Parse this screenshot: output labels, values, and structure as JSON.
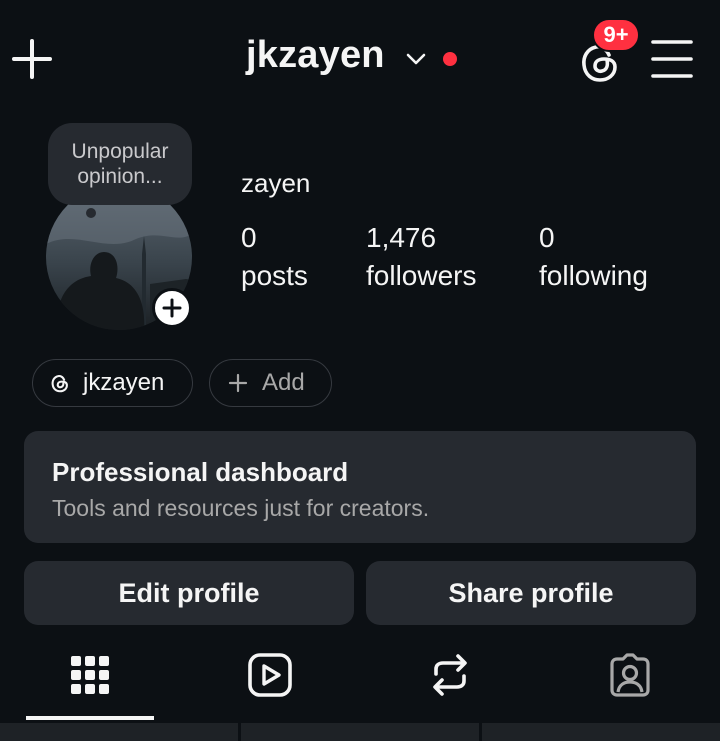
{
  "header": {
    "username": "jkzayen",
    "notifications_badge": "9+",
    "icons": {
      "create": "plus-icon",
      "account_switch": "chevron-down-icon",
      "threads": "threads-icon",
      "menu": "hamburger-menu-icon"
    },
    "live_dot_color": "#ff3040"
  },
  "profile": {
    "note": "Unpopular opinion...",
    "display_name": "zayen",
    "stats": [
      {
        "value": "0",
        "label": "posts"
      },
      {
        "value": "1,476",
        "label": "followers"
      },
      {
        "value": "0",
        "label": "following"
      }
    ]
  },
  "links": {
    "threads_handle": "jkzayen",
    "add_label": "Add"
  },
  "dashboard": {
    "title": "Professional dashboard",
    "subtitle": "Tools and resources just for creators."
  },
  "actions": {
    "edit": "Edit profile",
    "share": "Share profile"
  },
  "tabs": [
    {
      "name": "posts-grid",
      "icon": "grid-icon",
      "active": true
    },
    {
      "name": "reels",
      "icon": "reels-icon",
      "active": false
    },
    {
      "name": "reposts",
      "icon": "repost-icon",
      "active": false
    },
    {
      "name": "tagged",
      "icon": "tagged-user-icon",
      "active": false
    }
  ],
  "colors": {
    "background": "#0c1014",
    "surface": "#262a30",
    "text": "#f5f5f5",
    "muted_text": "#a8a8a8",
    "accent_red": "#ff3040"
  }
}
